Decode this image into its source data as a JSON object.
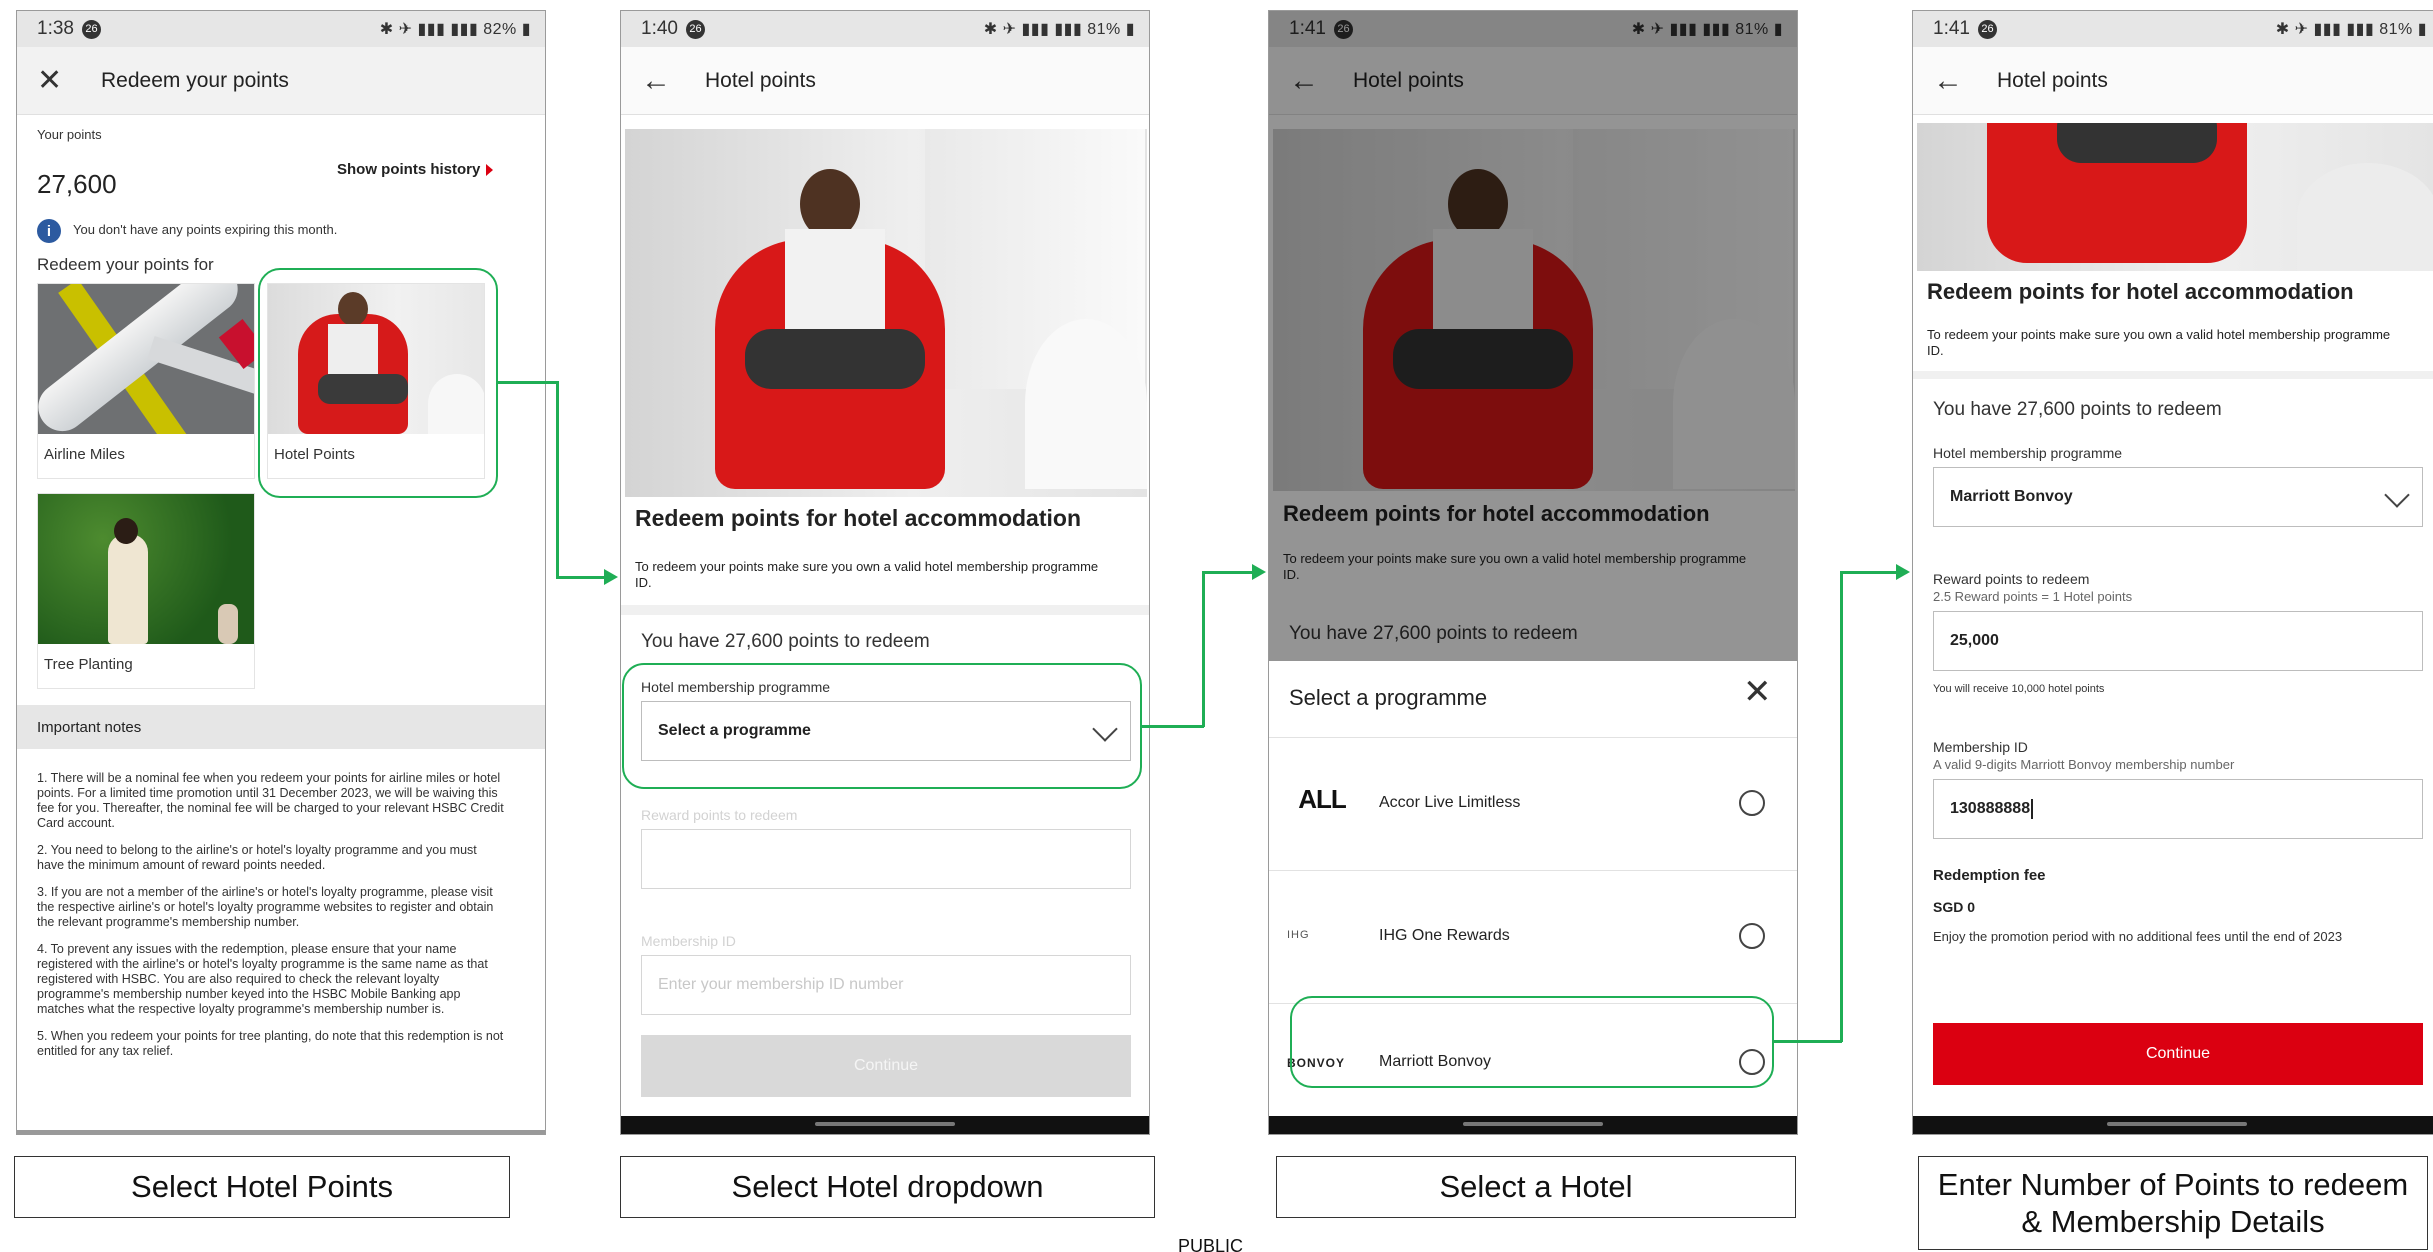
{
  "status_bars": [
    {
      "time": "1:38",
      "notif": "26",
      "battery": "82%"
    },
    {
      "time": "1:40",
      "notif": "26",
      "battery": "81%"
    },
    {
      "time": "1:41",
      "notif": "26",
      "battery": "81%"
    },
    {
      "time": "1:41",
      "notif": "26",
      "battery": "81%"
    }
  ],
  "screen1": {
    "title": "Redeem your points",
    "your_points_label": "Your points",
    "points_value": "27,600",
    "show_history": "Show points history",
    "info_text": "You don't have any points expiring this month.",
    "redeem_for": "Redeem your points for",
    "options": [
      "Airline Miles",
      "Hotel Points",
      "Tree Planting"
    ],
    "notes_heading": "Important notes",
    "notes": [
      "1. There will be a nominal fee when you redeem your points for airline miles or hotel points. For a limited time promotion until 31 December 2023, we will be waiving this fee for you. Thereafter, the nominal fee will be charged to your relevant HSBC Credit Card account.",
      "2. You need to belong to the airline's or hotel's loyalty programme and you must have the minimum amount of reward points needed.",
      "3. If you are not a member of the airline's or hotel's loyalty programme, please visit the respective airline's or hotel's loyalty programme websites to register and obtain the relevant programme's membership number.",
      "4. To prevent any issues with the redemption, please ensure that your name registered with the airline's or hotel's loyalty programme is the same name as that registered with HSBC. You are also required to check the relevant loyalty programme's membership number keyed into the HSBC Mobile Banking app matches what the respective loyalty programme's membership number is.",
      "5. When you redeem your points for tree planting, do note that this redemption is not entitled for any tax relief."
    ]
  },
  "hotel": {
    "title": "Hotel points",
    "heading": "Redeem points for hotel accommodation",
    "sub": "To redeem your points make sure you own a valid hotel membership programme ID.",
    "have_points": "You have 27,600 points to redeem",
    "programme_label": "Hotel membership programme",
    "programme_placeholder": "Select a programme",
    "reward_label": "Reward points to redeem",
    "membership_label": "Membership ID",
    "membership_placeholder": "Enter your membership ID number",
    "continue": "Continue"
  },
  "sheet": {
    "title": "Select a programme",
    "programmes": [
      {
        "logo": "ALL",
        "name": "Accor Live Limitless"
      },
      {
        "logo": "IHG",
        "name": "IHG One Rewards"
      },
      {
        "logo": "BONVOY",
        "name": "Marriott Bonvoy"
      }
    ]
  },
  "screen4": {
    "selected_programme": "Marriott Bonvoy",
    "rate": "2.5 Reward points = 1 Hotel points",
    "reward_value": "25,000",
    "receive_note": "You will receive 10,000 hotel points",
    "membership_sub": "A valid 9-digits Marriott Bonvoy membership number",
    "membership_value": "130888888",
    "fee_label": "Redemption fee",
    "fee_value": "SGD 0",
    "fee_note": "Enjoy the promotion period with no additional fees until the end of 2023"
  },
  "captions": [
    "Select Hotel Points",
    "Select Hotel dropdown",
    "Select a Hotel",
    "Enter Number of Points to redeem & Membership Details"
  ],
  "footer": "PUBLIC",
  "colors": {
    "accent_green": "#1fae55",
    "hsbc_red": "#db0011"
  }
}
